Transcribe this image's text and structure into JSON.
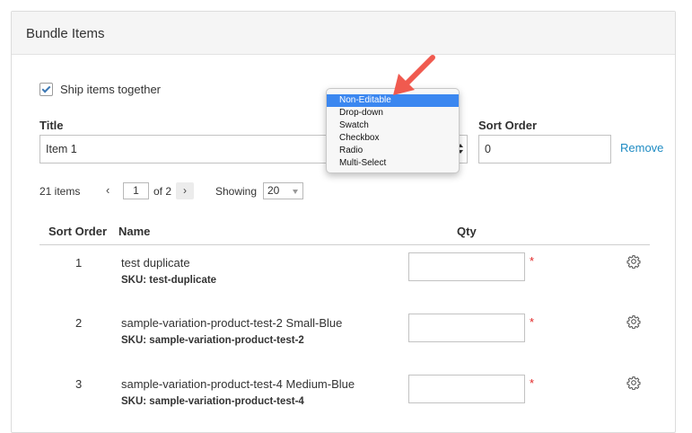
{
  "panel": {
    "title": "Bundle Items"
  },
  "ship_together": {
    "label": "Ship items together",
    "checked": true
  },
  "item_row": {
    "title_label": "Title",
    "title_value": "Item 1",
    "sort_order_label": "Sort Order",
    "sort_order_value": "0",
    "remove_label": "Remove"
  },
  "input_type_dropdown": {
    "options": [
      "Non-Editable",
      "Drop-down",
      "Swatch",
      "Checkbox",
      "Radio",
      "Multi-Select"
    ],
    "highlighted": "Non-Editable"
  },
  "pager": {
    "count_label": "21 items",
    "prev": "‹",
    "current_page": "1",
    "of_label": "of 2",
    "next": "›",
    "showing_label": "Showing",
    "showing_value": "20"
  },
  "table": {
    "headers": {
      "sort_order": "Sort Order",
      "name": "Name",
      "qty": "Qty"
    },
    "rows": [
      {
        "sort": "1",
        "name": "test duplicate",
        "sku": "SKU: test-duplicate",
        "qty": "",
        "required": "*"
      },
      {
        "sort": "2",
        "name": "sample-variation-product-test-2 Small-Blue",
        "sku": "SKU: sample-variation-product-test-2",
        "qty": "",
        "required": "*"
      },
      {
        "sort": "3",
        "name": "sample-variation-product-test-4 Medium-Blue",
        "sku": "SKU: sample-variation-product-test-4",
        "qty": "",
        "required": "*"
      }
    ]
  },
  "colors": {
    "link": "#1e8bc3",
    "highlight": "#3b87f0",
    "required": "#e22626",
    "annotation_arrow": "#f05a4f"
  },
  "icons": {
    "row_settings": "gear-icon",
    "checkbox": "checkmark-icon",
    "annotation": "red-arrow-icon"
  }
}
